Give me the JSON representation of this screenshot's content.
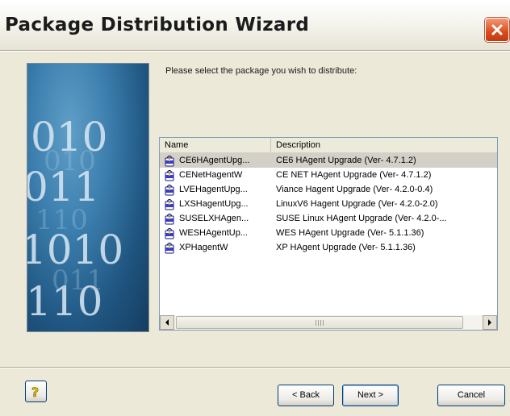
{
  "window": {
    "title": "Package Distribution Wizard"
  },
  "banner": {
    "digits": [
      "010",
      "011",
      "1010",
      "110"
    ]
  },
  "page": {
    "instruction": "Please select the package you wish to distribute:"
  },
  "list": {
    "columns": {
      "name": "Name",
      "description": "Description"
    },
    "rows": [
      {
        "name": "CE6HAgentUpg...",
        "description": "CE6 HAgent Upgrade (Ver- 4.7.1.2)",
        "selected": true
      },
      {
        "name": "CENetHagentW",
        "description": "CE NET HAgent Upgrade (Ver- 4.7.1.2)",
        "selected": false
      },
      {
        "name": "LVEHagentUpg...",
        "description": "Viance Hagent Upgrade (Ver- 4.2.0-0.4)",
        "selected": false
      },
      {
        "name": "LXSHagentUpg...",
        "description": "LinuxV6 Hagent Upgrade (Ver- 4.2.0-2.0)",
        "selected": false
      },
      {
        "name": "SUSELXHAgen...",
        "description": "SUSE Linux HAgent Upgrade (Ver- 4.2.0-...",
        "selected": false
      },
      {
        "name": "WESHAgentUp...",
        "description": "WES HAgent Upgrade (Ver- 5.1.1.36)",
        "selected": false
      },
      {
        "name": "XPHagentW",
        "description": "XP HAgent Upgrade (Ver- 5.1.1.36)",
        "selected": false
      }
    ]
  },
  "buttons": {
    "back": "< Back",
    "next": "Next >",
    "cancel": "Cancel"
  },
  "colors": {
    "selection": "#d4d0c8",
    "close_button": "#dc4a1c",
    "banner": "#3c7eae"
  },
  "icons": {
    "close": "close-icon",
    "help": "help-icon",
    "package": "package-icon"
  }
}
